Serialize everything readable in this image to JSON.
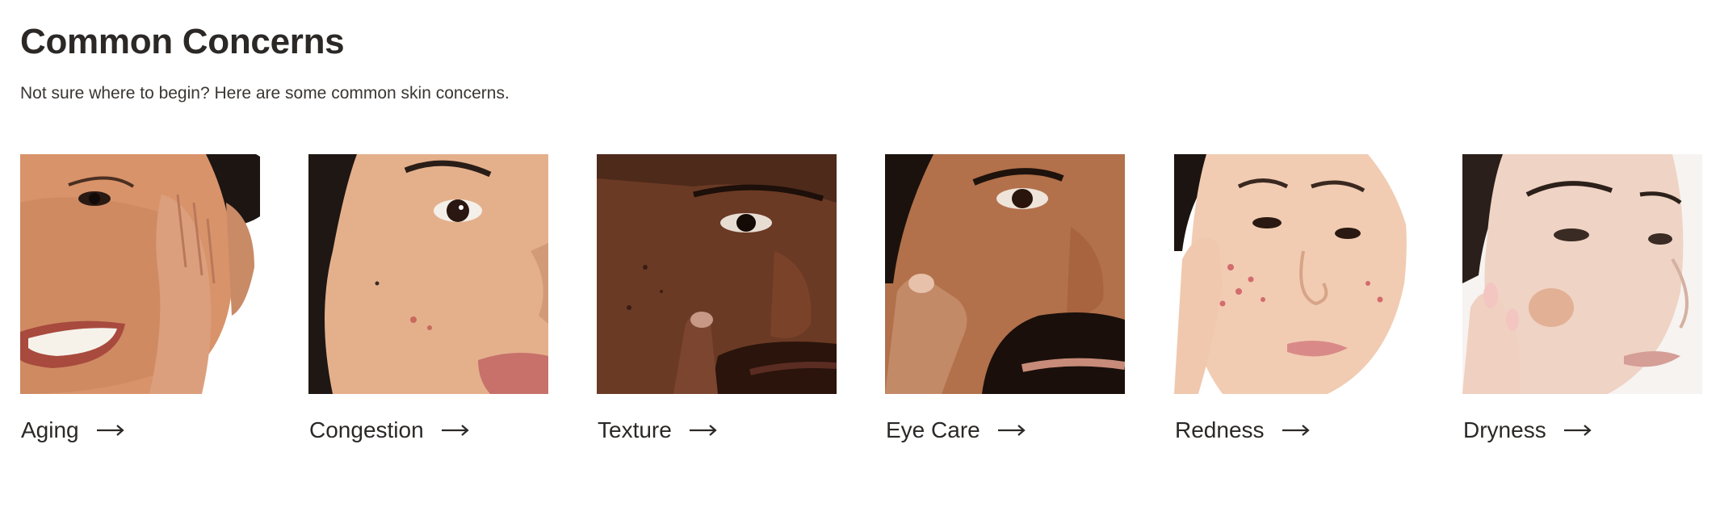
{
  "section": {
    "title": "Common Concerns",
    "subtitle": "Not sure where to begin? Here are some common skin concerns."
  },
  "concerns": [
    {
      "label": "Aging",
      "image_icon": "aging-face-photo",
      "arrow_icon": "arrow-right-icon"
    },
    {
      "label": "Congestion",
      "image_icon": "congestion-face-photo",
      "arrow_icon": "arrow-right-icon"
    },
    {
      "label": "Texture",
      "image_icon": "texture-face-photo",
      "arrow_icon": "arrow-right-icon"
    },
    {
      "label": "Eye Care",
      "image_icon": "eye-care-face-photo",
      "arrow_icon": "arrow-right-icon"
    },
    {
      "label": "Redness",
      "image_icon": "redness-face-photo",
      "arrow_icon": "arrow-right-icon"
    },
    {
      "label": "Dryness",
      "image_icon": "dryness-face-photo",
      "arrow_icon": "arrow-right-icon"
    }
  ],
  "colors": {
    "text": "#2b2826",
    "background": "#ffffff"
  }
}
